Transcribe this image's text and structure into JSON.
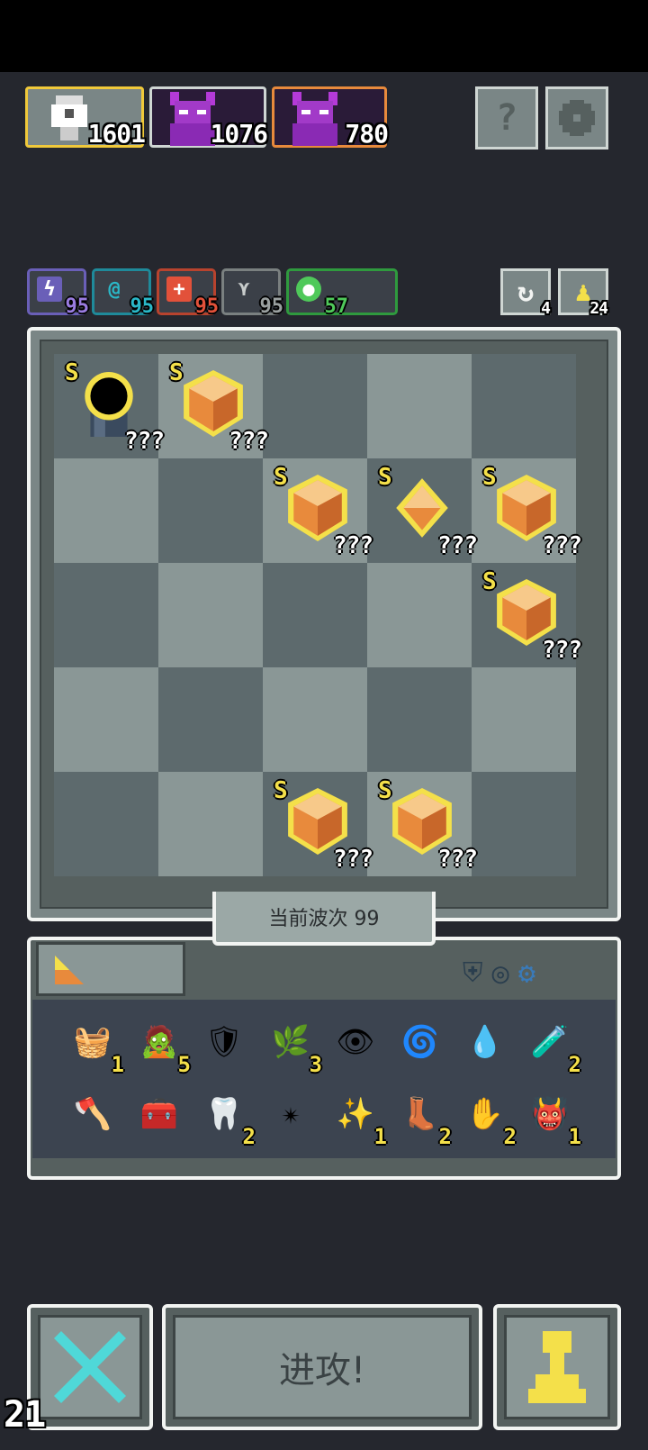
{
  "header": {
    "units": [
      {
        "icon": "knight-portrait-icon",
        "value": "1601"
      },
      {
        "icon": "purple-demon-portrait-icon",
        "value": "1076"
      },
      {
        "icon": "purple-demon-portrait-icon",
        "value": "780"
      }
    ],
    "help_label": "?",
    "settings_icon": "gear-icon"
  },
  "stats": [
    {
      "icon": "lightning-icon",
      "value": "95",
      "color": "#9a7ce0"
    },
    {
      "icon": "spiral-icon",
      "value": "95",
      "color": "#2ab8c8"
    },
    {
      "icon": "plus-icon",
      "value": "95",
      "color": "#e2513a"
    },
    {
      "icon": "wing-icon",
      "value": "95",
      "color": "#9aa0a0"
    },
    {
      "icon": "leaf-icon",
      "value": "57",
      "color": "#4fc95a"
    }
  ],
  "side_counters": [
    {
      "icon": "refresh-icon",
      "value": "4"
    },
    {
      "icon": "pawn-icon",
      "value": "24"
    }
  ],
  "board": {
    "pieces": [
      {
        "type": "bomber",
        "rank": "S",
        "label": "???"
      },
      {
        "type": "gem",
        "rank": "S",
        "label": "???"
      },
      {
        "type": "gem",
        "rank": "S",
        "label": "???"
      },
      {
        "type": "gem-small",
        "rank": "S",
        "label": "???"
      },
      {
        "type": "gem",
        "rank": "S",
        "label": "???"
      },
      {
        "type": "gem",
        "rank": "S",
        "label": "???"
      },
      {
        "type": "gem",
        "rank": "S",
        "label": "???"
      },
      {
        "type": "gem",
        "rank": "S",
        "label": "???"
      }
    ],
    "wave_label": "当前波次 99"
  },
  "inventory": {
    "tab_icon": "wedge-icon",
    "filter_icons": [
      "armor-filter-icon",
      "ring-filter-icon",
      "gear-filter-icon"
    ],
    "items": [
      {
        "icon": "bucket-icon",
        "glyph": "🧺",
        "count": "1"
      },
      {
        "icon": "zombie-icon",
        "glyph": "🧟",
        "count": "5"
      },
      {
        "icon": "shield-icon",
        "glyph": "🛡",
        "count": ""
      },
      {
        "icon": "herb-icon",
        "glyph": "🌿",
        "count": "3"
      },
      {
        "icon": "eye-orb-icon",
        "glyph": "👁",
        "count": ""
      },
      {
        "icon": "blue-wisp-icon",
        "glyph": "🌀",
        "count": ""
      },
      {
        "icon": "water-drop-icon",
        "glyph": "💧",
        "count": ""
      },
      {
        "icon": "potion-jar-icon",
        "glyph": "🧪",
        "count": "2"
      },
      {
        "icon": "purple-axe-icon",
        "glyph": "🪓",
        "count": ""
      },
      {
        "icon": "treasure-chest-icon",
        "glyph": "🧰",
        "count": ""
      },
      {
        "icon": "claw-icon",
        "glyph": "🦷",
        "count": "2"
      },
      {
        "icon": "shuriken-icon",
        "glyph": "✴",
        "count": ""
      },
      {
        "icon": "spark-icon",
        "glyph": "✨",
        "count": "1"
      },
      {
        "icon": "boot-icon",
        "glyph": "👢",
        "count": "2"
      },
      {
        "icon": "palm-icon",
        "glyph": "✋",
        "count": "2"
      },
      {
        "icon": "demon-mask-icon",
        "glyph": "👹",
        "count": "1"
      }
    ]
  },
  "actions": {
    "cancel_icon": "x-icon",
    "attack_label": "进攻!",
    "pawn_icon": "pawn-icon",
    "corner_counter": "21"
  }
}
